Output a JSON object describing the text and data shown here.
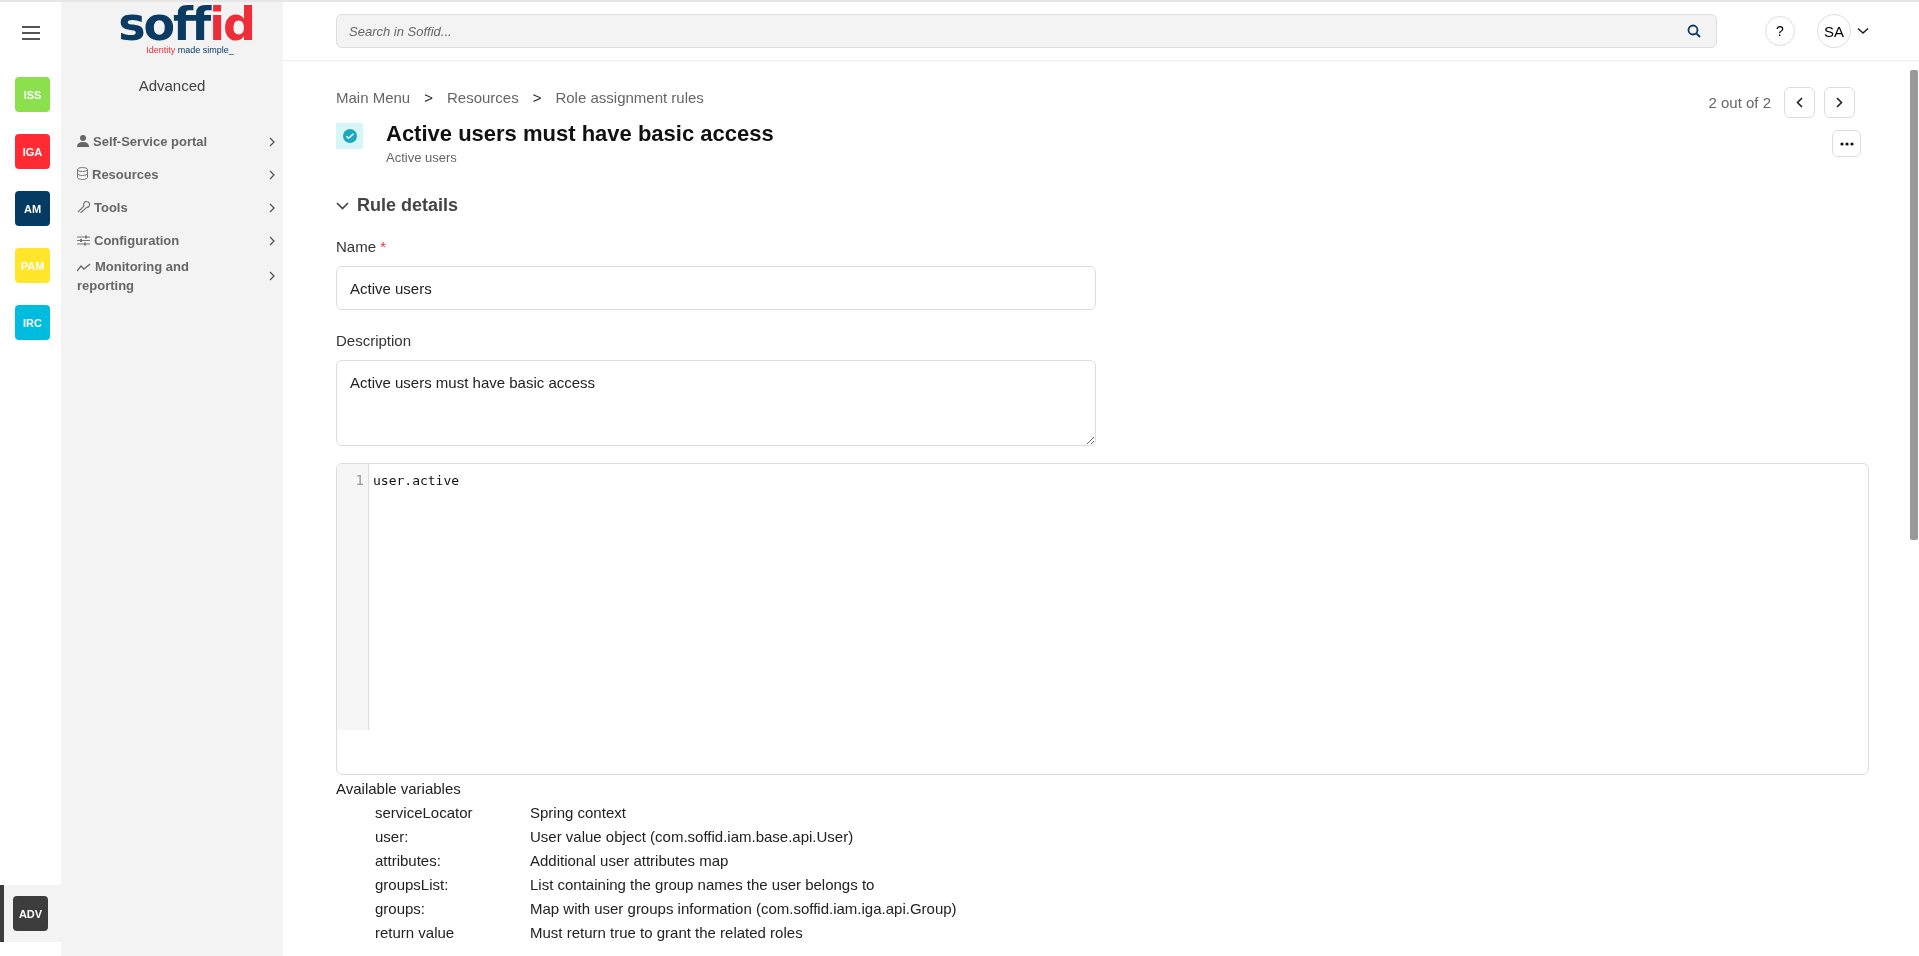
{
  "logo": {
    "main": "soff",
    "accent": "id",
    "tagline_accent": "Identity",
    "tagline": "made simple_"
  },
  "rail": [
    {
      "label": "ISS",
      "color": "#8be04e",
      "selected": false
    },
    {
      "label": "IGA",
      "color": "#ff2a32",
      "selected": false
    },
    {
      "label": "AM",
      "color": "#053b63",
      "selected": false
    },
    {
      "label": "PAM",
      "color": "#ffe62a",
      "selected": false
    },
    {
      "label": "IRC",
      "color": "#00bde0",
      "selected": false
    },
    {
      "label": "ADV",
      "color": "#3d3d3d",
      "selected": true
    }
  ],
  "sidebar": {
    "title": "Advanced",
    "items": [
      {
        "label": "Self-Service portal"
      },
      {
        "label": "Resources"
      },
      {
        "label": "Tools"
      },
      {
        "label": "Configuration"
      },
      {
        "label": "Monitoring and reporting"
      }
    ]
  },
  "search": {
    "placeholder": "Search in Soffid..."
  },
  "help": "?",
  "user": "SA",
  "breadcrumb": [
    {
      "label": "Main Menu"
    },
    {
      "label": "Resources"
    },
    {
      "label": "Role assignment rules"
    }
  ],
  "breadcrumb_separator": ">",
  "pager": "2 out of 2",
  "title": "Active users must have basic access",
  "subtitle": "Active users",
  "section": {
    "title": "Rule details",
    "expanded": true
  },
  "name_field": {
    "label": "Name",
    "required_mark": "*",
    "value": "Active users"
  },
  "description_field": {
    "label": "Description",
    "value": "Active users must have basic access"
  },
  "code": {
    "lines": [
      {
        "number": "1",
        "text": "user.active"
      }
    ]
  },
  "variables": {
    "title": "Available variables",
    "rows": [
      {
        "name": "serviceLocator",
        "description": "Spring context"
      },
      {
        "name": "user:",
        "description": "User value object (com.soffid.iam.base.api.User)"
      },
      {
        "name": "attributes:",
        "description": "Additional user attributes map"
      },
      {
        "name": "groupsList:",
        "description": "List containing the group names the user belongs to"
      },
      {
        "name": "groups:",
        "description": "Map with user groups information (com.soffid.iam.iga.api.Group)"
      },
      {
        "name": "return value",
        "description": "Must return true to grant the related roles"
      }
    ]
  }
}
